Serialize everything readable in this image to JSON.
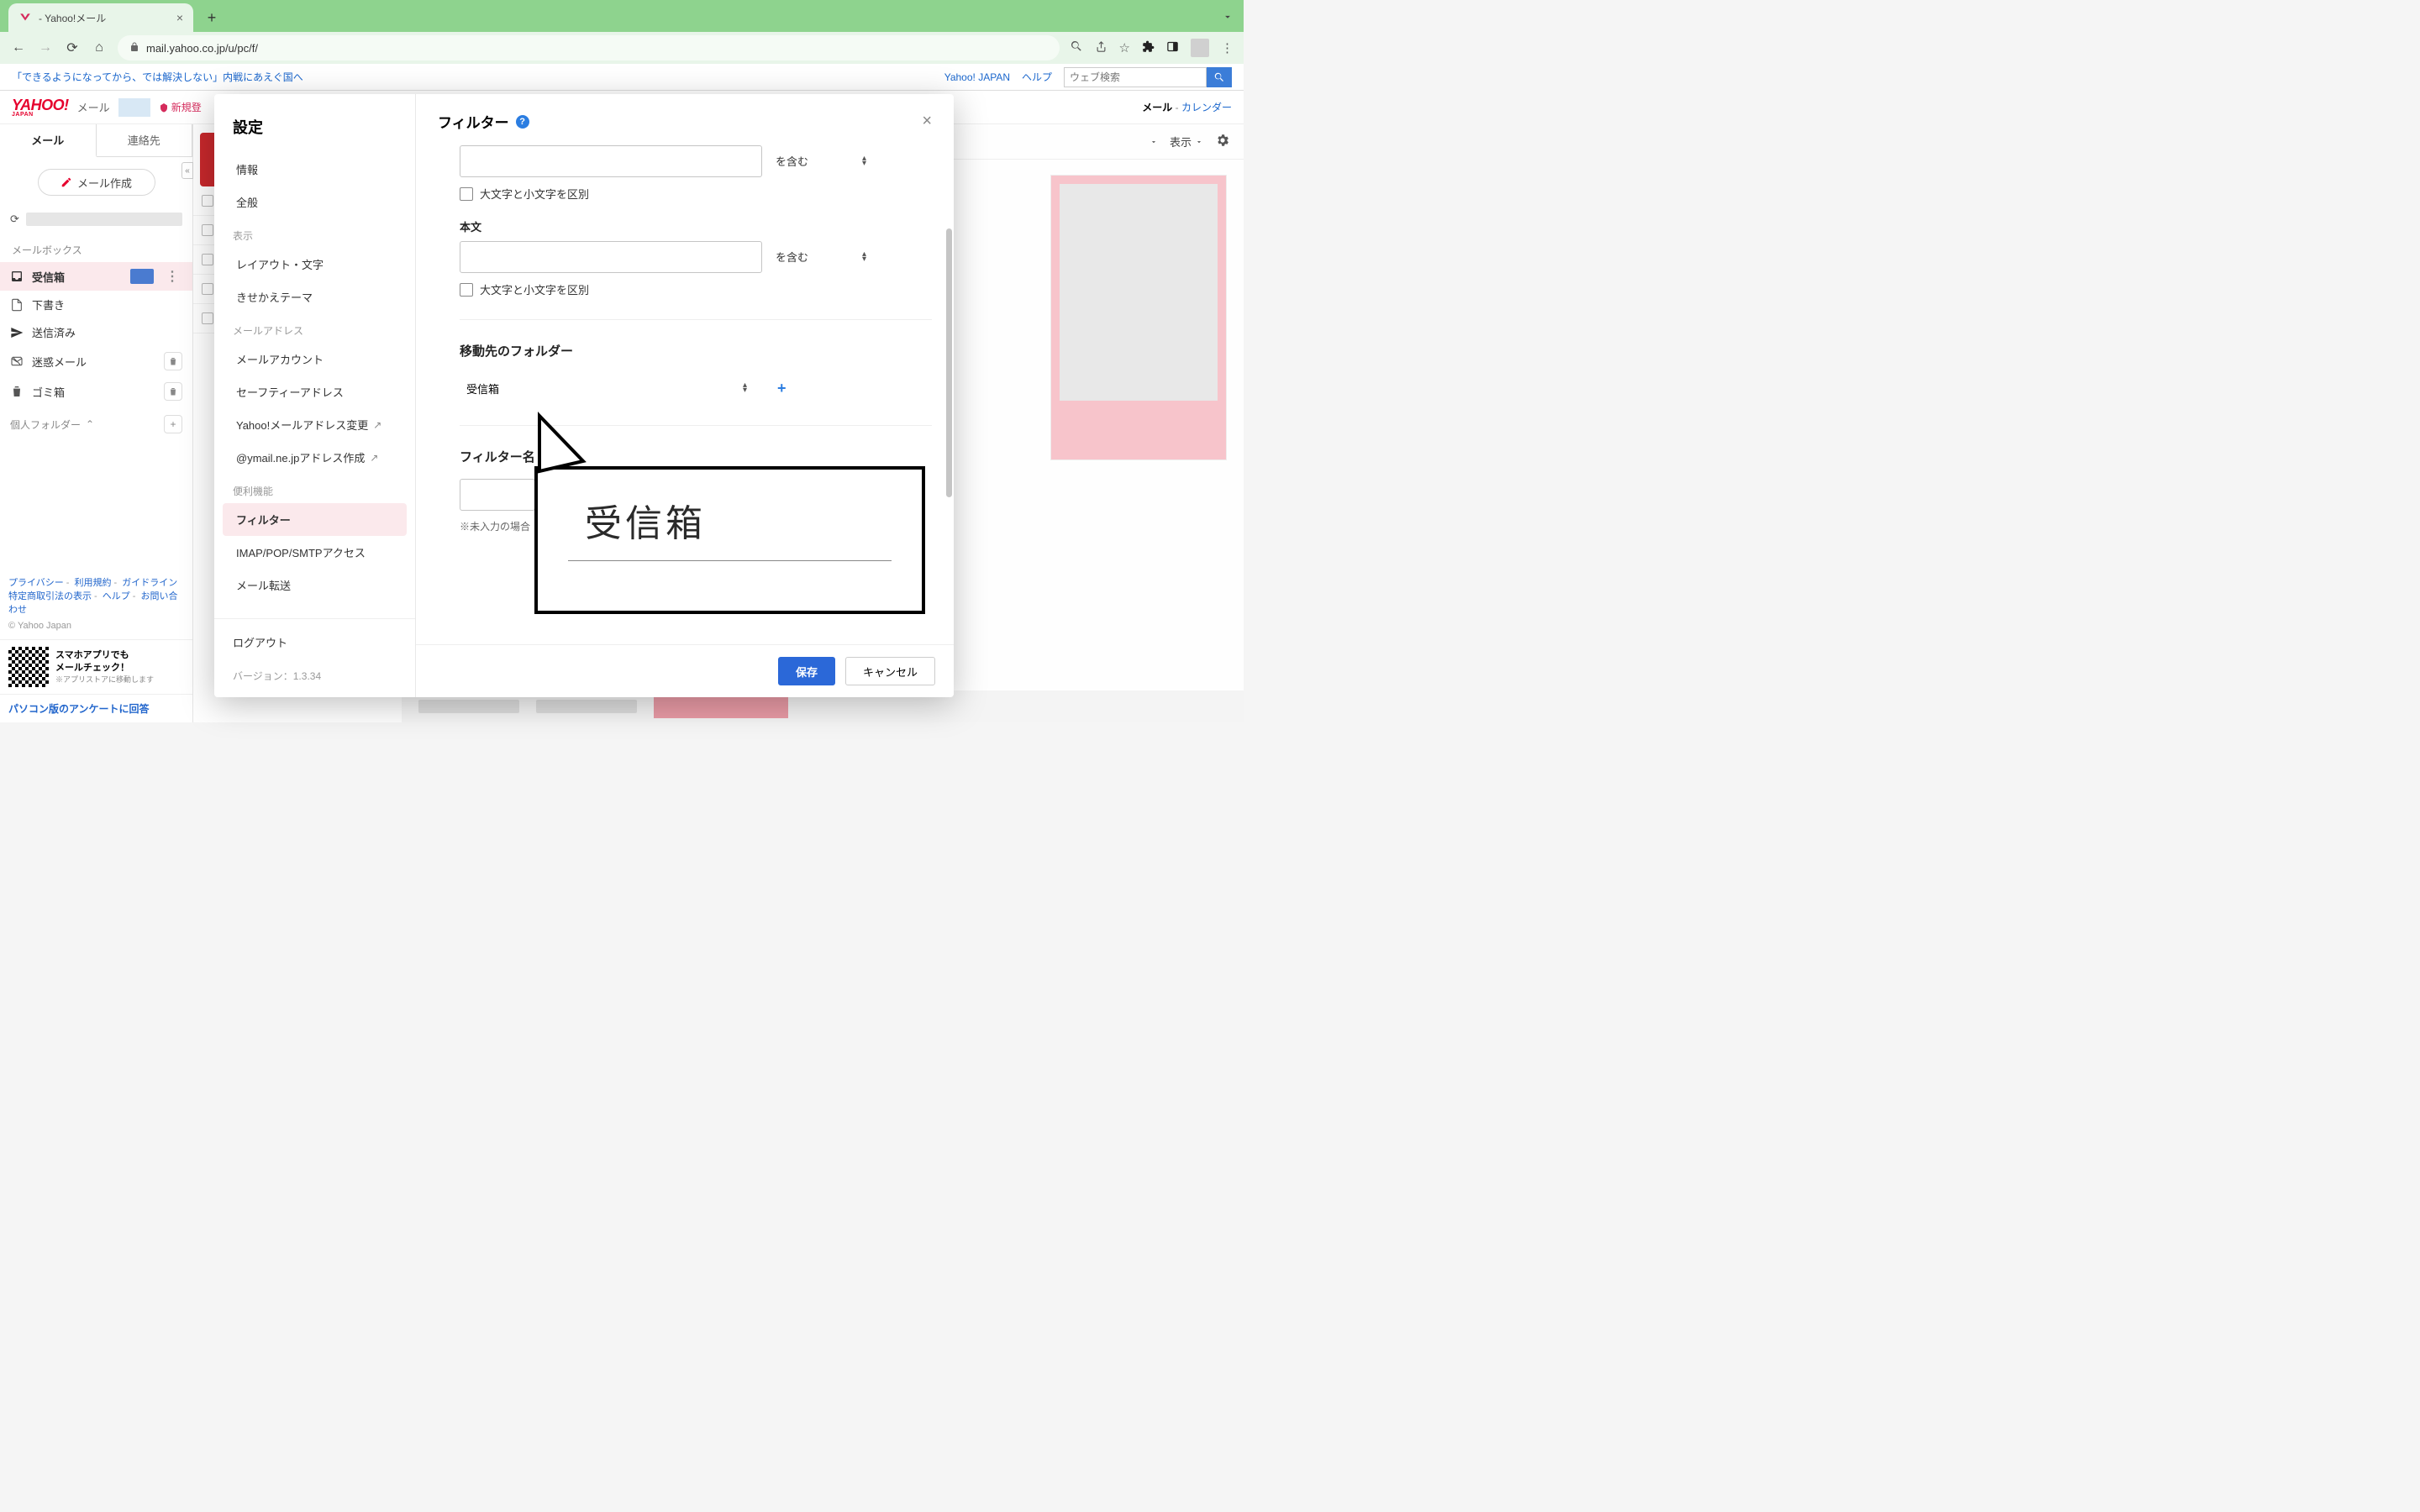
{
  "browser": {
    "tab_title": " - Yahoo!メール",
    "url_display": "mail.yahoo.co.jp/u/pc/f/"
  },
  "topbar": {
    "news_headline": "「できるようになってから、では解決しない」内戦にあえぐ国へ",
    "yahoo_japan": "Yahoo! JAPAN",
    "help": "ヘルプ",
    "web_search_placeholder": "ウェブ検索"
  },
  "mail_header": {
    "logo_main": "YAHOO!",
    "logo_sub": "JAPAN",
    "mail_label": "メール",
    "paypay": "新規登",
    "right_links": {
      "mail": "メール",
      "calendar": "カレンダー"
    }
  },
  "sidebar": {
    "tabs": {
      "mail": "メール",
      "contacts": "連絡先"
    },
    "compose": "メール作成",
    "mailbox_label": "メールボックス",
    "folders": {
      "inbox": "受信箱",
      "drafts": "下書き",
      "sent": "送信済み",
      "spam": "迷惑メール",
      "trash": "ゴミ箱"
    },
    "personal_folders": "個人フォルダー",
    "footer_links": {
      "privacy": "プライバシー",
      "terms": "利用規約",
      "guidelines": "ガイドライン",
      "commerce": "特定商取引法の表示",
      "help": "ヘルプ",
      "contact": "お問い合わせ"
    },
    "copyright": "© Yahoo Japan",
    "app_promo_line1": "スマホアプリでも",
    "app_promo_line2": "メールチェック！",
    "app_promo_sub": "※アプリストアに移動します",
    "survey": "パソコン版のアンケートに回答"
  },
  "content_toolbar": {
    "display": "表示"
  },
  "modal": {
    "sidebar_title": "設定",
    "groups": {
      "info": "情報",
      "general": "全般",
      "display_group": "表示",
      "layout": "レイアウト・文字",
      "theme": "きせかえテーマ",
      "mail_address_group": "メールアドレス",
      "account": "メールアカウント",
      "safety": "セーフティーアドレス",
      "yahoo_addr_change": "Yahoo!メールアドレス変更",
      "ymail_create": "@ymail.ne.jpアドレス作成",
      "convenience_group": "便利機能",
      "filter": "フィルター",
      "imap": "IMAP/POP/SMTPアクセス",
      "forward": "メール転送"
    },
    "logout": "ログアウト",
    "version": "バージョン：1.3.34",
    "title": "フィルター",
    "body_label": "本文",
    "contains": "を含む",
    "case_sensitive": "大文字と小文字を区別",
    "dest_folder_title": "移動先のフォルダー",
    "dest_folder_value": "受信箱",
    "filter_name_title": "フィルター名",
    "filter_name_note": "※未入力の場合",
    "save": "保存",
    "cancel": "キャンセル"
  },
  "callout": {
    "text": "受信箱"
  }
}
